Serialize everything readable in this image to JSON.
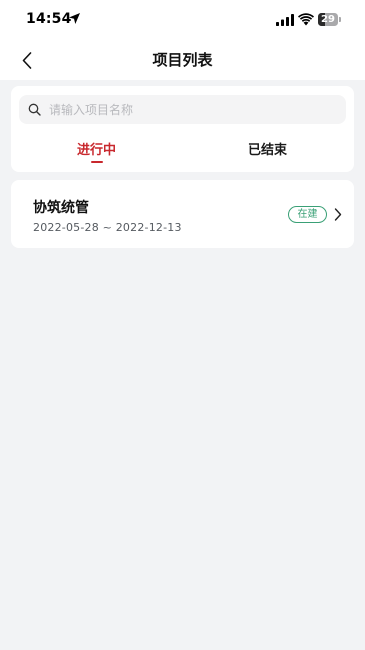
{
  "status_bar": {
    "time": "14:54",
    "battery": "29"
  },
  "nav": {
    "title": "项目列表"
  },
  "search": {
    "placeholder": "请输入项目名称",
    "value": ""
  },
  "tabs": [
    {
      "label": "进行中",
      "active": true
    },
    {
      "label": "已结束",
      "active": false
    }
  ],
  "projects": [
    {
      "name": "协筑统管",
      "dates": "2022-05-28 ~ 2022-12-13",
      "status": "在建"
    }
  ],
  "colors": {
    "accent": "#c8282d",
    "status_green": "#3aa076",
    "background": "#f2f3f5"
  }
}
